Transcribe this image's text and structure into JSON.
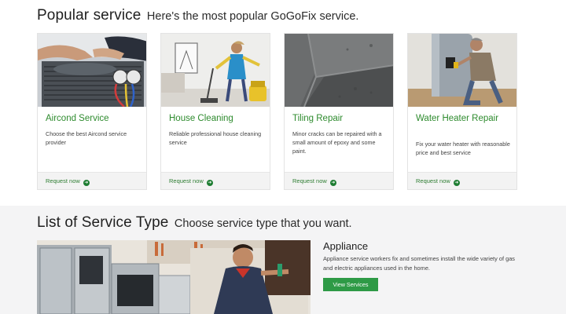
{
  "popular": {
    "title": "Popular service",
    "subtitle": "Here's the most popular GoGoFix service.",
    "cards": [
      {
        "title": "Aircond Service",
        "desc": "Choose the best Aircond service provider",
        "link": "Request now"
      },
      {
        "title": "House Cleaning",
        "desc": "Reliable professional house cleaning service",
        "link": "Request now"
      },
      {
        "title": "Tiling Repair",
        "desc": "Minor cracks can be repaired with a small amount of epoxy and some paint.",
        "link": "Request now"
      },
      {
        "title": "Water Heater Repair",
        "desc": "Fix your water heater with reasonable price and best service",
        "link": "Request now"
      }
    ]
  },
  "types": {
    "title": "List of Service Type",
    "subtitle": "Choose service type that you want.",
    "appliance": {
      "title": "Appliance",
      "desc": "Appliance service workers fix and sometimes install the wide variety of gas and electric appliances used in the home.",
      "button": "View Services"
    }
  },
  "colors": {
    "accent": "#2e8b2e",
    "button": "#2e9a46",
    "footer_bg": "#f3f3f3",
    "section_bg": "#f4f4f5"
  }
}
